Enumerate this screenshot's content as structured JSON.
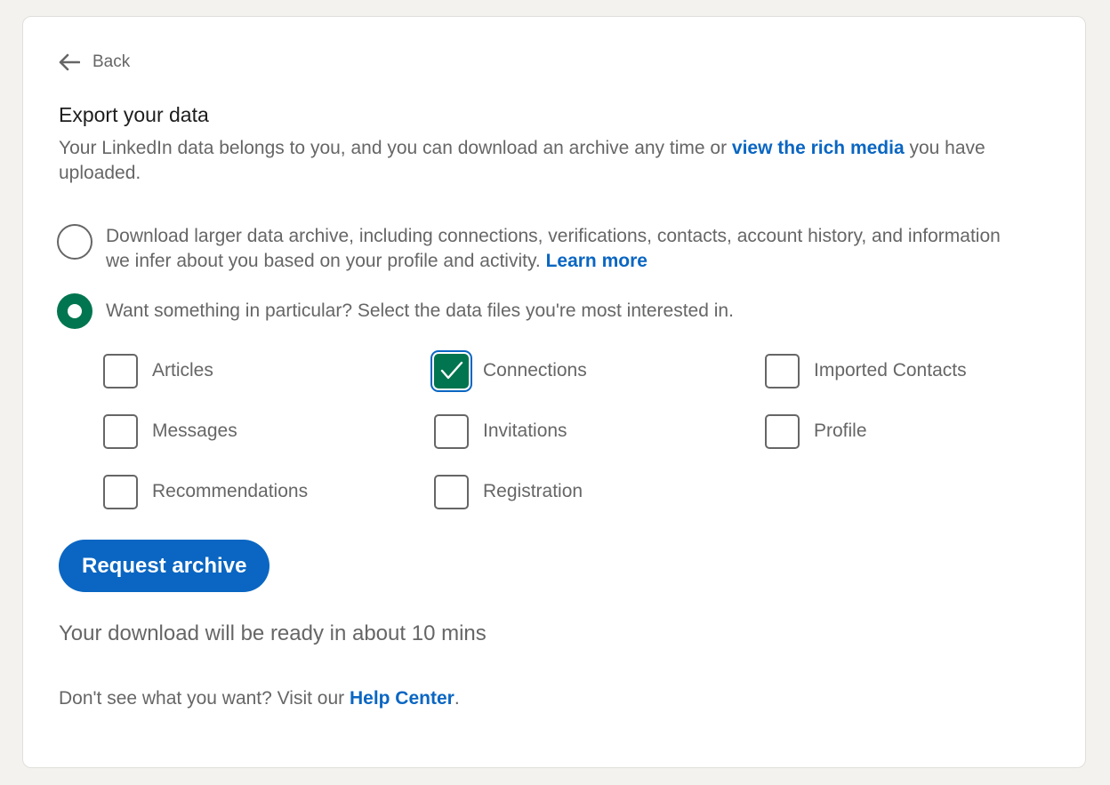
{
  "back": {
    "label": "Back",
    "icon": "arrow-left-icon"
  },
  "page": {
    "title": "Export your data",
    "description_before": "Your LinkedIn data belongs to you, and you can download an archive any time or ",
    "description_link": "view the rich media",
    "description_after": " you have uploaded."
  },
  "options": {
    "larger_archive": {
      "text": "Download larger data archive, including connections, verifications, contacts, account history, and information we infer about you based on your profile and activity. ",
      "link": "Learn more",
      "selected": false
    },
    "particular": {
      "text": "Want something in particular? Select the data files you're most interested in.",
      "selected": true
    }
  },
  "data_files": [
    {
      "label": "Articles",
      "checked": false
    },
    {
      "label": "Connections",
      "checked": true
    },
    {
      "label": "Imported Contacts",
      "checked": false
    },
    {
      "label": "Messages",
      "checked": false
    },
    {
      "label": "Invitations",
      "checked": false
    },
    {
      "label": "Profile",
      "checked": false
    },
    {
      "label": "Recommendations",
      "checked": false
    },
    {
      "label": "Registration",
      "checked": false
    }
  ],
  "actions": {
    "request_label": "Request archive"
  },
  "status": {
    "ready_text": "Your download will be ready in about 10 mins"
  },
  "help": {
    "before": "Don't see what you want? Visit our ",
    "link": "Help Center",
    "after": "."
  },
  "colors": {
    "accent": "#0a66c2",
    "selected_green": "#01754f",
    "text": "#666666",
    "background": "#f4f2ee"
  }
}
